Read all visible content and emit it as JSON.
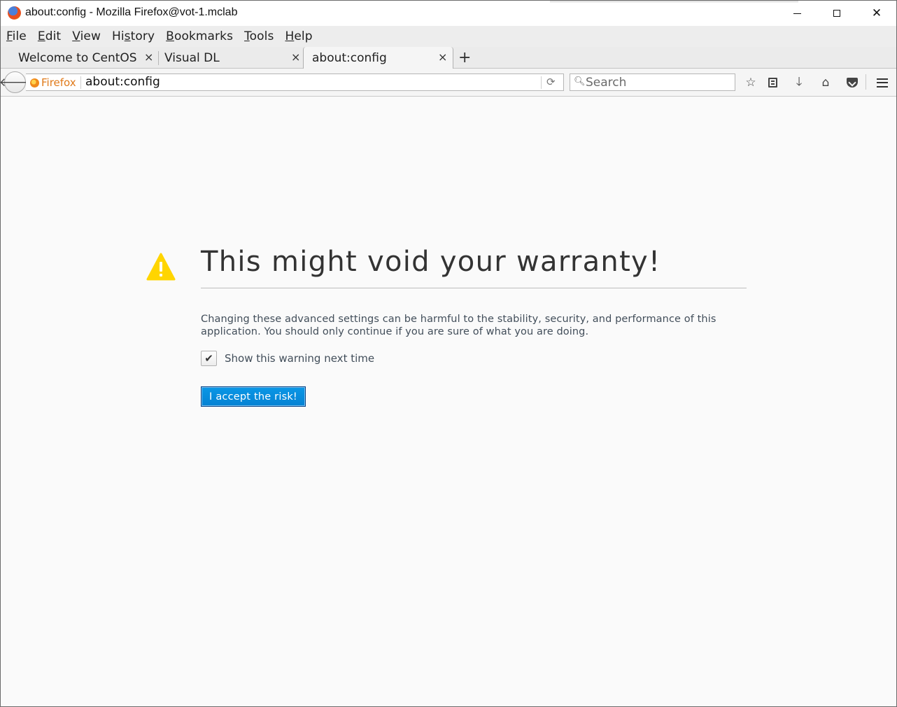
{
  "window": {
    "title": "about:config - Mozilla Firefox@vot-1.mclab",
    "app_icon": "firefox-icon"
  },
  "menubar": {
    "items": [
      {
        "label": "File",
        "mnemonic": "F",
        "rest": "ile"
      },
      {
        "label": "Edit",
        "mnemonic": "E",
        "rest": "dit"
      },
      {
        "label": "View",
        "mnemonic": "V",
        "rest": "iew"
      },
      {
        "label": "History",
        "pre": "Hi",
        "mnemonic": "s",
        "rest": "tory"
      },
      {
        "label": "Bookmarks",
        "mnemonic": "B",
        "rest": "ookmarks"
      },
      {
        "label": "Tools",
        "mnemonic": "T",
        "rest": "ools"
      },
      {
        "label": "Help",
        "mnemonic": "H",
        "rest": "elp"
      }
    ]
  },
  "tabs": [
    {
      "label": "Welcome to CentOS",
      "close": "×",
      "active": false
    },
    {
      "label": "Visual DL",
      "close": "×",
      "active": false
    },
    {
      "label": "about:config",
      "close": "×",
      "active": true
    }
  ],
  "new_tab_label": "+",
  "navbar": {
    "identity_label": "Firefox",
    "url": "about:config",
    "search_placeholder": "Search",
    "icons": [
      "back-arrow-icon",
      "reload-icon",
      "search-icon",
      "bookmark-star-icon",
      "bookmarks-list-icon",
      "download-icon",
      "home-icon",
      "pocket-icon",
      "hamburger-menu-icon"
    ]
  },
  "content": {
    "heading": "This might void your warranty!",
    "description": "Changing these advanced settings can be harmful to the stability, security, and performance of this application. You should only continue if you are sure of what you are doing.",
    "checkbox_label": "Show this warning next time",
    "checkbox_checked": true,
    "accept_button": "I accept the risk!",
    "warning_icon": "warning-triangle-icon"
  },
  "colors": {
    "accent_button": "#0a8fe2",
    "warning_yellow": "#ffd500",
    "identity_orange": "#e07a1a"
  }
}
